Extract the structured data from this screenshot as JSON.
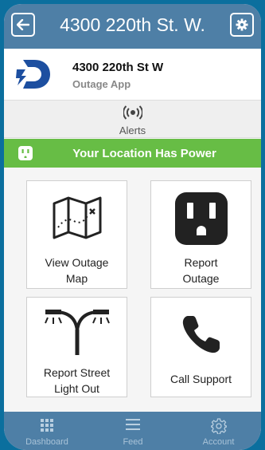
{
  "header": {
    "title": "4300 220th St. W."
  },
  "brand": {
    "address": "4300 220th St W",
    "app_name": "Outage App"
  },
  "alerts": {
    "label": "Alerts"
  },
  "power_status": {
    "label": "Your Location Has Power"
  },
  "tiles": {
    "view_map": "View Outage\nMap",
    "report_outage": "Report\nOutage",
    "street_light": "Report Street\nLight Out",
    "call_support": "Call Support"
  },
  "tabbar": {
    "dashboard": "Dashboard",
    "feed": "Feed",
    "account": "Account"
  },
  "colors": {
    "header": "#4e7fa6",
    "power_ok": "#67bd45",
    "logo": "#1d4fa0"
  }
}
